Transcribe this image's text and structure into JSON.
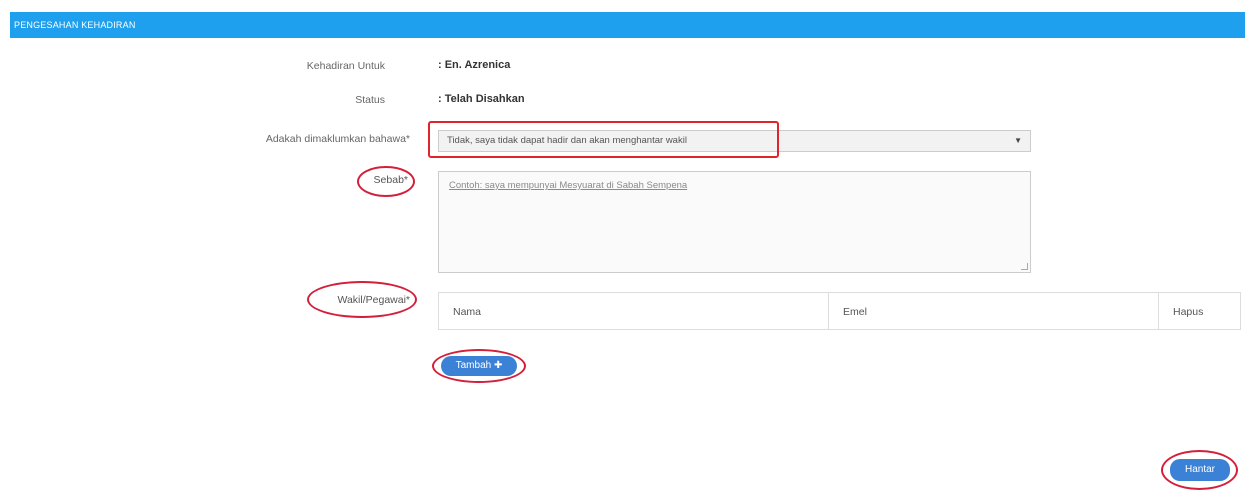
{
  "header": {
    "title": "PENGESAHAN KEHADIRAN"
  },
  "form": {
    "attendance_for_label": "Kehadiran Untuk",
    "attendance_for_value": ": En. Azrenica",
    "status_label": "Status",
    "status_value": ": Telah Disahkan",
    "confirm_label": "Adakah dimaklumkan bahawa*",
    "confirm_selected": "Tidak, saya tidak dapat hadir dan akan menghantar wakil",
    "reason_label": "Sebab*",
    "reason_placeholder": "Contoh: saya mempunyai Mesyuarat di Sabah Sempena",
    "rep_label": "Wakil/Pegawai*",
    "table_headers": [
      "Nama",
      "Emel",
      "Hapus"
    ],
    "add_button": "Tambah ✚",
    "submit_button": "Hantar"
  },
  "colors": {
    "header": "#1ea0ee",
    "annotation": "#d41f3b",
    "button": "#3b82d6"
  }
}
